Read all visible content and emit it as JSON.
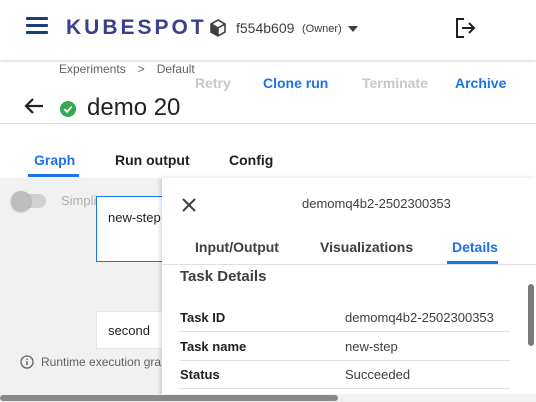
{
  "app": {
    "logo": "KUBESPOT",
    "namespace": "f554b609",
    "namespace_role": "(Owner)"
  },
  "icons": {
    "menu": "hamburger-menu-icon",
    "namespace": "cube-icon",
    "namespace_dropdown": "caret-down-icon",
    "logout": "logout-icon",
    "back": "arrow-left-icon",
    "status": "check-circle-icon",
    "close": "close-icon",
    "info": "info-icon"
  },
  "colors": {
    "accent": "#1a73e8",
    "logo": "#3a3f8f",
    "success": "#34a853",
    "disabled": "#c8c8c8"
  },
  "breadcrumb": {
    "items": [
      "Experiments",
      "Default"
    ],
    "separator": ">"
  },
  "run": {
    "title": "demo 20",
    "status": "Succeeded"
  },
  "actions": {
    "retry": "Retry",
    "clone": "Clone run",
    "terminate": "Terminate",
    "archive": "Archive"
  },
  "tabs": {
    "graph": "Graph",
    "run_output": "Run output",
    "config": "Config",
    "active": "Graph"
  },
  "graph": {
    "simplify_label": "Simpli",
    "simplify_enabled": false,
    "nodes": [
      "new-step",
      "second"
    ],
    "runtime_note": "Runtime execution gra"
  },
  "panel": {
    "title": "demomq4b2-2502300353",
    "tabs": {
      "input_output": "Input/Output",
      "visualizations": "Visualizations",
      "details": "Details",
      "active": "Details"
    },
    "section_title": "Task Details",
    "details": [
      {
        "key": "Task ID",
        "value": "demomq4b2-2502300353"
      },
      {
        "key": "Task name",
        "value": "new-step"
      },
      {
        "key": "Status",
        "value": "Succeeded"
      }
    ]
  }
}
